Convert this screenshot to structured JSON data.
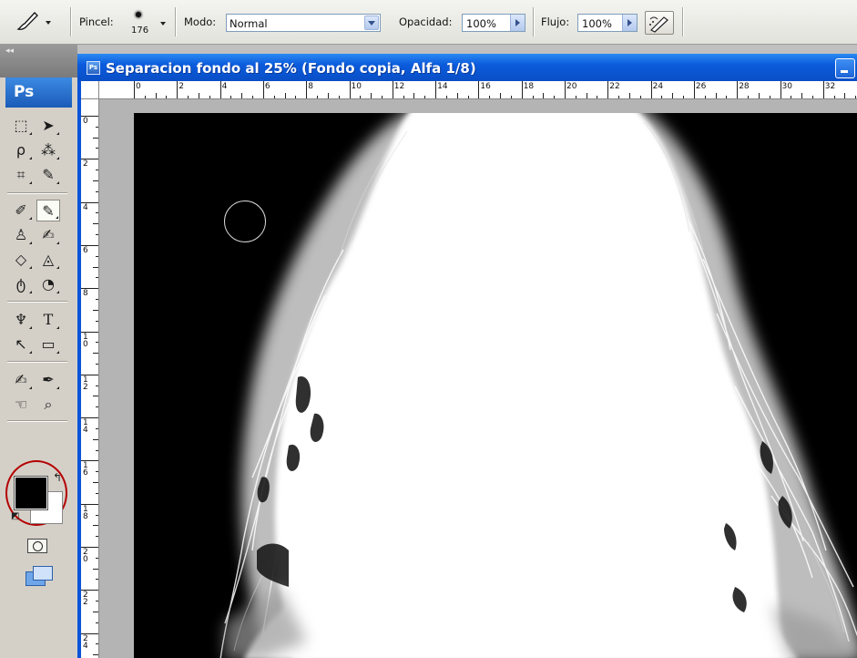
{
  "options_bar": {
    "brush_label": "Pincel:",
    "brush_size": "176",
    "mode_label": "Modo:",
    "mode_value": "Normal",
    "opacity_label": "Opacidad:",
    "opacity_value": "100%",
    "flow_label": "Flujo:",
    "flow_value": "100%"
  },
  "toolbox": {
    "logo": "Ps",
    "collapse_glyph": "◂◂",
    "tools": {
      "marquee": "⬚",
      "move": "➤",
      "lasso": "ρ",
      "magic_wand": "⁂",
      "crop": "⌗",
      "slice": "✎",
      "healing": "✐",
      "brush": "✎",
      "stamp": "♙",
      "history_brush": "✍",
      "eraser": "◇",
      "bucket": "◬",
      "blur": "ტ",
      "dodge": "◔",
      "pen": "♆",
      "type": "T",
      "path_select": "↖",
      "shape": "▭",
      "notes": "✍",
      "eyedropper": "✒",
      "hand": "☜",
      "zoom": "⌕"
    },
    "foreground_color": "#000000",
    "background_color": "#ffffff",
    "swap_glyph": "↰",
    "default_glyph": "◩"
  },
  "document": {
    "title": "Separacion fondo al 25% (Fondo copia, Alfa 1/8)",
    "icon_text": "Ps",
    "ruler_h_labels": [
      "0",
      "2",
      "4",
      "6",
      "8",
      "10",
      "12",
      "14",
      "16",
      "18",
      "20",
      "22",
      "24",
      "26",
      "28",
      "30",
      "32"
    ],
    "ruler_v_labels": [
      "0",
      "2",
      "4",
      "6",
      "8",
      "10",
      "12",
      "14",
      "16",
      "18",
      "20",
      "22",
      "24"
    ]
  },
  "colors": {
    "titlebar": "#0b5bdc",
    "highlight_circle": "#b40000",
    "canvas": "#000000"
  }
}
